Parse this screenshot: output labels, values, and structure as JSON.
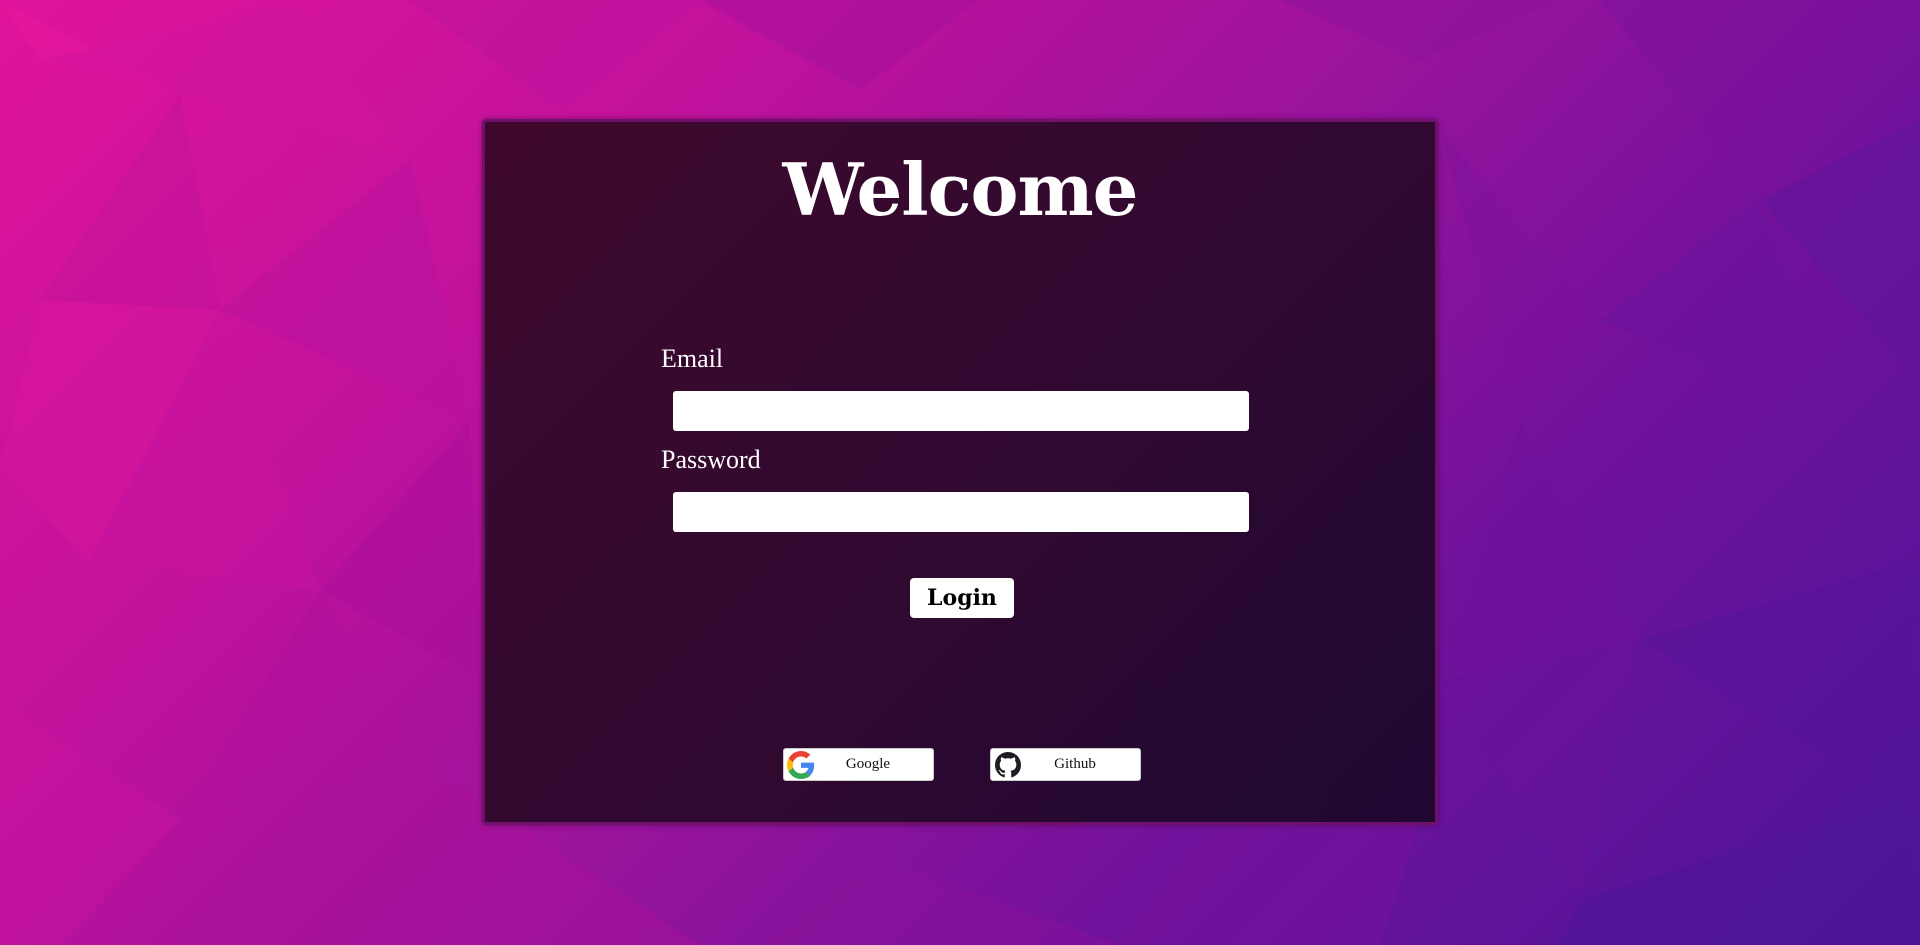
{
  "page": {
    "title": "Welcome"
  },
  "form": {
    "email_label": "Email",
    "email_value": "",
    "password_label": "Password",
    "password_value": "",
    "login_label": "Login"
  },
  "social": {
    "google_label": "Google",
    "google_icon": "google-icon",
    "github_label": "Github",
    "github_icon": "github-icon"
  },
  "colors": {
    "background_start": "#e0149a",
    "background_end": "#4a1499",
    "card_background": "#2a0930",
    "card_border": "#70106a",
    "text": "#ffffff"
  }
}
